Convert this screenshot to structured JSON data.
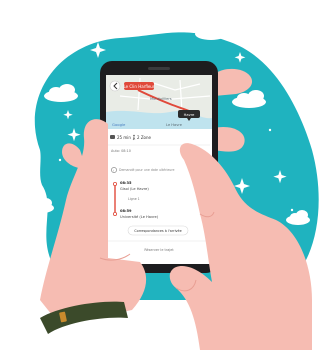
{
  "colors": {
    "blob": "#1fb3bf",
    "phone": "#1d1d1f",
    "skin": "#f6bcb2",
    "skin_dark": "#e89e93",
    "map_land": "#e9ece6",
    "map_water": "#bfe3ee",
    "route": "#e0493a",
    "accent_green": "#1f8f6b",
    "strap": "#3b4a2a",
    "strap_buckle": "#c98a2d"
  },
  "map": {
    "pin_label": "Le Clin Harfleur",
    "city_label_1": "Montivilliers",
    "city_label_2": "Le Havre",
    "tooltip_label": "Havre",
    "google_label": "Google"
  },
  "trip": {
    "duration": "25 min",
    "fare": "2 Zone",
    "depart_label": "Auto: 08:10",
    "freq_label": "5/6",
    "info_text": "Demandé pour une date ultérieure"
  },
  "stops": [
    {
      "time": "08:35",
      "name": "Gisol (Le Havre)"
    },
    {
      "time": "",
      "name": "Ligne 1"
    },
    {
      "time": "08:59",
      "name": "Université (Le Havre)"
    }
  ],
  "buttons": {
    "connections": "Correspondances à l'arrivée",
    "more": "Réserver le trajet"
  },
  "icons": {
    "back": "back-arrow-icon",
    "bus": "bus-icon",
    "walk": "walk-icon",
    "info": "info-icon",
    "pin": "map-pin-icon",
    "star": "sparkle-icon",
    "cloud": "cloud-icon"
  }
}
